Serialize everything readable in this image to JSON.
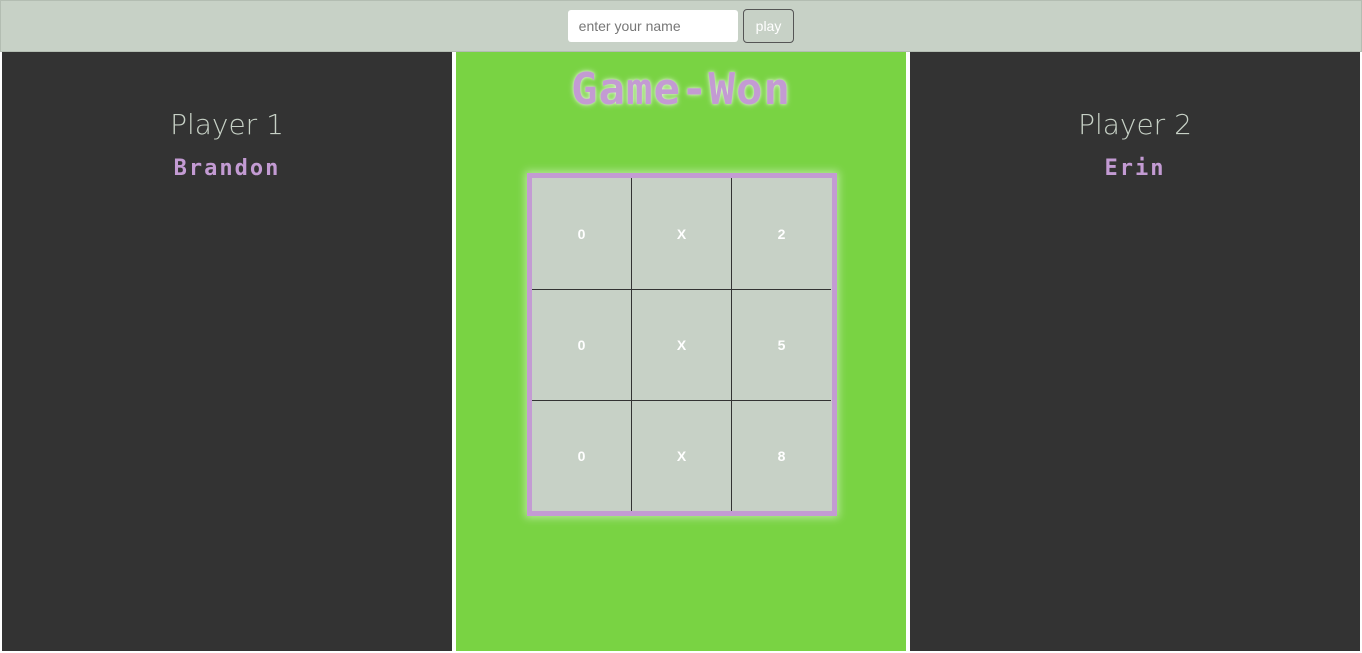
{
  "topbar": {
    "name_placeholder": "enter your name",
    "play_label": "play"
  },
  "players": [
    {
      "label": "Player 1",
      "name": "Brandon"
    },
    {
      "label": "Player 2",
      "name": "Erin"
    }
  ],
  "game": {
    "status_title": "Game-Won",
    "board": [
      "0",
      "X",
      "2",
      "0",
      "X",
      "5",
      "0",
      "X",
      "8"
    ]
  },
  "colors": {
    "topbar_bg": "#c7d1c6",
    "side_panel_bg": "#333333",
    "center_panel_bg": "#79d343",
    "accent_purple": "#c39bd3",
    "cell_bg": "#c7d1c6"
  }
}
